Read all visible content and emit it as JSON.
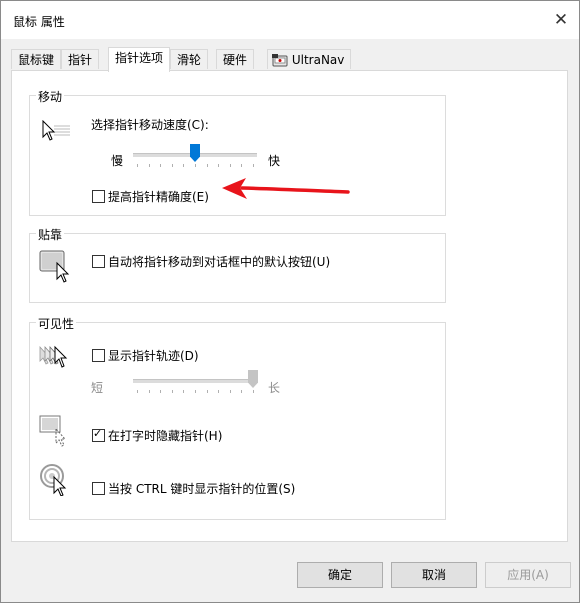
{
  "window": {
    "title": "鼠标 属性",
    "close_glyph": "✕"
  },
  "tabs": [
    {
      "label": "鼠标键"
    },
    {
      "label": "指针"
    },
    {
      "label": "指针选项",
      "active": true
    },
    {
      "label": "滑轮"
    },
    {
      "label": "硬件"
    },
    {
      "label": "UltraNav",
      "icon": "trackpoint-icon"
    }
  ],
  "motion": {
    "group_title": "移动",
    "speed_label": "选择指针移动速度(C):",
    "slow_label": "慢",
    "fast_label": "快",
    "speed_level_fraction": 0.5,
    "precision_label": "提高指针精确度(E)",
    "precision_checked": false,
    "icon": "pointer-speed-icon",
    "annotation": "red-arrow-pointing-to-precision-option"
  },
  "snap": {
    "group_title": "贴靠",
    "snap_label": "自动将指针移动到对话框中的默认按钮(U)",
    "snap_checked": false,
    "icon": "snap-to-button-icon"
  },
  "visibility": {
    "group_title": "可见性",
    "trails_label": "显示指针轨迹(D)",
    "trails_checked": false,
    "short_label": "短",
    "long_label": "长",
    "trail_length_fraction": 1.0,
    "hide_label": "在打字时隐藏指针(H)",
    "hide_checked": true,
    "ctrl_label": "当按 CTRL 键时显示指针的位置(S)",
    "ctrl_checked": false,
    "icons": [
      "pointer-trails-icon",
      "hide-pointer-icon",
      "ctrl-locate-icon"
    ]
  },
  "buttons": {
    "ok": "确定",
    "cancel": "取消",
    "apply": "应用(A)"
  },
  "colors": {
    "accent": "#0078d7",
    "annotation_red": "#e8141b",
    "disabled_text": "#9a9a9a"
  }
}
